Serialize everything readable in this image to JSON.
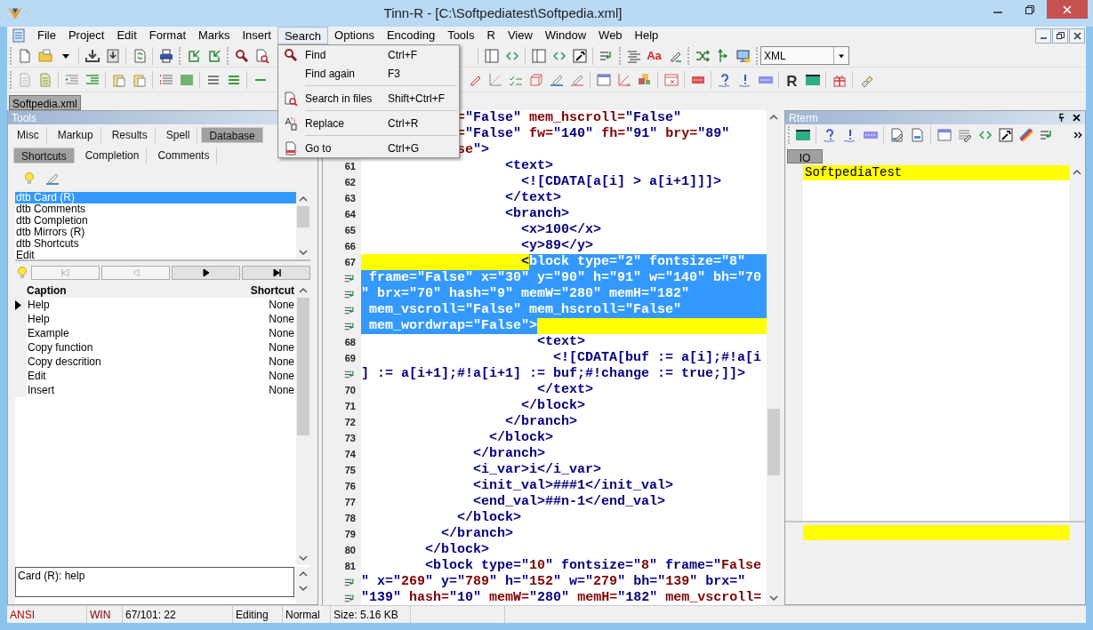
{
  "window": {
    "title": "Tinn-R - [C:\\Softpediatest\\Softpedia.xml]"
  },
  "menu": [
    {
      "label": "File",
      "selected": false
    },
    {
      "label": "Project",
      "selected": false
    },
    {
      "label": "Edit",
      "selected": false
    },
    {
      "label": "Format",
      "selected": false
    },
    {
      "label": "Marks",
      "selected": false
    },
    {
      "label": "Insert",
      "selected": false
    },
    {
      "label": "Search",
      "selected": true
    },
    {
      "label": "Options",
      "selected": false
    },
    {
      "label": "Encoding",
      "selected": false
    },
    {
      "label": "Tools",
      "selected": false
    },
    {
      "label": "R",
      "selected": false
    },
    {
      "label": "View",
      "selected": false
    },
    {
      "label": "Window",
      "selected": false
    },
    {
      "label": "Web",
      "selected": false
    },
    {
      "label": "Help",
      "selected": false
    }
  ],
  "search_menu": [
    {
      "kind": "command",
      "label": "Find",
      "shortcut": "Ctrl+F"
    },
    {
      "kind": "command",
      "label": "Find again",
      "shortcut": "F3"
    },
    {
      "kind": "separator"
    },
    {
      "kind": "command",
      "label": "Search in files",
      "shortcut": "Shift+Ctrl+F"
    },
    {
      "kind": "separator"
    },
    {
      "kind": "command",
      "label": "Replace",
      "shortcut": "Ctrl+R"
    },
    {
      "kind": "separator"
    },
    {
      "kind": "command",
      "label": "Go to",
      "shortcut": "Ctrl+G"
    }
  ],
  "toolbar": {
    "font_button": "Aa",
    "language": "XML",
    "r_button": "R"
  },
  "document_tabs": [
    {
      "label": "Softpedia.xml",
      "selected": true
    }
  ],
  "tools_panel": {
    "title": "Tools",
    "tabs": [
      {
        "label": "Misc",
        "selected": false
      },
      {
        "label": "Markup",
        "selected": false
      },
      {
        "label": "Results",
        "selected": false
      },
      {
        "label": "Spell",
        "selected": false
      },
      {
        "label": "Database",
        "selected": true
      }
    ],
    "subtabs": [
      {
        "label": "Shortcuts",
        "selected": true
      },
      {
        "label": "Completion",
        "selected": false
      },
      {
        "label": "Comments",
        "selected": false
      }
    ],
    "list": [
      {
        "label": "dtb Card (R)",
        "selected": true
      },
      {
        "label": "dtb Comments",
        "selected": false
      },
      {
        "label": "dtb Completion",
        "selected": false
      },
      {
        "label": "dtb Mirrors (R)",
        "selected": false
      },
      {
        "label": "dtb Shortcuts",
        "selected": false
      },
      {
        "label": "Edit",
        "selected": false
      }
    ],
    "nav_buttons": [
      {
        "kind": "first",
        "disabled": true
      },
      {
        "kind": "prev",
        "disabled": true
      },
      {
        "kind": "next",
        "disabled": false
      },
      {
        "kind": "last",
        "disabled": false
      }
    ],
    "columns": [
      "Caption",
      "Shortcut"
    ],
    "rows": [
      {
        "caption": "Help",
        "shortcut": "None",
        "current": true
      },
      {
        "caption": "Help",
        "shortcut": "None",
        "current": false
      },
      {
        "caption": "Example",
        "shortcut": "None",
        "current": false
      },
      {
        "caption": "Copy function",
        "shortcut": "None",
        "current": false
      },
      {
        "caption": "Copy descrition",
        "shortcut": "None",
        "current": false
      },
      {
        "caption": "Edit",
        "shortcut": "None",
        "current": false
      },
      {
        "caption": "Insert",
        "shortcut": "None",
        "current": false
      }
    ],
    "memo": "Card (R): help"
  },
  "editor": {
    "lines": [
      {
        "kind": "plain",
        "text": "            =\"False\" mem_hscroll=\"False\""
      },
      {
        "kind": "plain",
        "text": "            =\"False\" fw=\"140\" fh=\"91\" bry=\"89\""
      },
      {
        "kind": "plain",
        "text": "            se\">"
      },
      {
        "kind": "numbered",
        "number": "61",
        "text": "                  <text>"
      },
      {
        "kind": "numbered",
        "number": "62",
        "text": "                    <![CDATA[a[i] > a[i+1]]]>"
      },
      {
        "kind": "numbered",
        "number": "63",
        "text": "                  </text>"
      },
      {
        "kind": "numbered",
        "number": "64",
        "text": "                  <branch>"
      },
      {
        "kind": "numbered",
        "number": "65",
        "text": "                    <x>100</x>"
      },
      {
        "kind": "numbered",
        "number": "66",
        "text": "                    <y>89</y>"
      },
      {
        "kind": "numbered",
        "number": "67",
        "text": "                    <",
        "selected_text": "block type=\"2\" fontsize=\"8\"",
        "current": true,
        "selection_to_end": true
      },
      {
        "kind": "wrapped",
        "selected_text": " frame=\"False\" x=\"30\" y=\"90\" h=\"91\" w=\"140\" bh=\"70",
        "current": true,
        "selection_to_end": true
      },
      {
        "kind": "wrapped",
        "selected_text": "\" brx=\"70\" hash=\"9\" memW=\"280\" memH=\"182\"",
        "current": true,
        "selection_to_end": true
      },
      {
        "kind": "wrapped",
        "selected_text": " mem_vscroll=\"False\" mem_hscroll=\"False\"",
        "current": true,
        "selection_to_end": true
      },
      {
        "kind": "wrapped",
        "selected_text": " mem_wordwrap=\"False\">",
        "current": true,
        "selection_to_end": false
      },
      {
        "kind": "numbered",
        "number": "68",
        "text": "                      <text>"
      },
      {
        "kind": "numbered",
        "number": "69",
        "text": "                        <![CDATA[buf := a[i];#!a[i"
      },
      {
        "kind": "wrapped",
        "text": "] := a[i+1];#!a[i+1] := buf;#!change := true;]]>"
      },
      {
        "kind": "numbered",
        "number": "70",
        "text": "                      </text>"
      },
      {
        "kind": "numbered",
        "number": "71",
        "text": "                    </block>"
      },
      {
        "kind": "numbered",
        "number": "72",
        "text": "                  </branch>"
      },
      {
        "kind": "numbered",
        "number": "73",
        "text": "                </block>"
      },
      {
        "kind": "numbered",
        "number": "74",
        "text": "              </branch>"
      },
      {
        "kind": "numbered",
        "number": "75",
        "text": "              <i_var>i</i_var>"
      },
      {
        "kind": "numbered",
        "number": "76",
        "text": "              <init_val>###1</init_val>"
      },
      {
        "kind": "numbered",
        "number": "77",
        "text": "              <end_val>##n-1</end_val>"
      },
      {
        "kind": "numbered",
        "number": "78",
        "text": "            </block>"
      },
      {
        "kind": "numbered",
        "number": "79",
        "text": "          </branch>"
      },
      {
        "kind": "numbered",
        "number": "80",
        "text": "        </block>"
      },
      {
        "kind": "numbered",
        "number": "81",
        "text": "        <block type=\"10\" fontsize=\"8\" frame=\"False"
      },
      {
        "kind": "wrapped",
        "text": "\" x=\"269\" y=\"789\" h=\"152\" w=\"279\" bh=\"139\" brx=\""
      },
      {
        "kind": "wrapped",
        "text": "\"139\" hash=\"10\" memW=\"280\" memH=\"182\" mem_vscroll="
      }
    ]
  },
  "rterm": {
    "title": "Rterm",
    "tabs": [
      {
        "label": "IO",
        "selected": true
      }
    ],
    "output_line": "SoftpediaTest"
  },
  "status_bar": [
    {
      "text": "ANSI",
      "color": "#c00000"
    },
    {
      "text": "WIN",
      "color": "#800000"
    },
    {
      "text": "67/101: 22",
      "color": "#000000"
    },
    {
      "text": "Editing",
      "color": "#000000"
    },
    {
      "text": "Normal",
      "color": "#000000"
    },
    {
      "text": "Size: 5.16 KB",
      "color": "#000000"
    }
  ]
}
